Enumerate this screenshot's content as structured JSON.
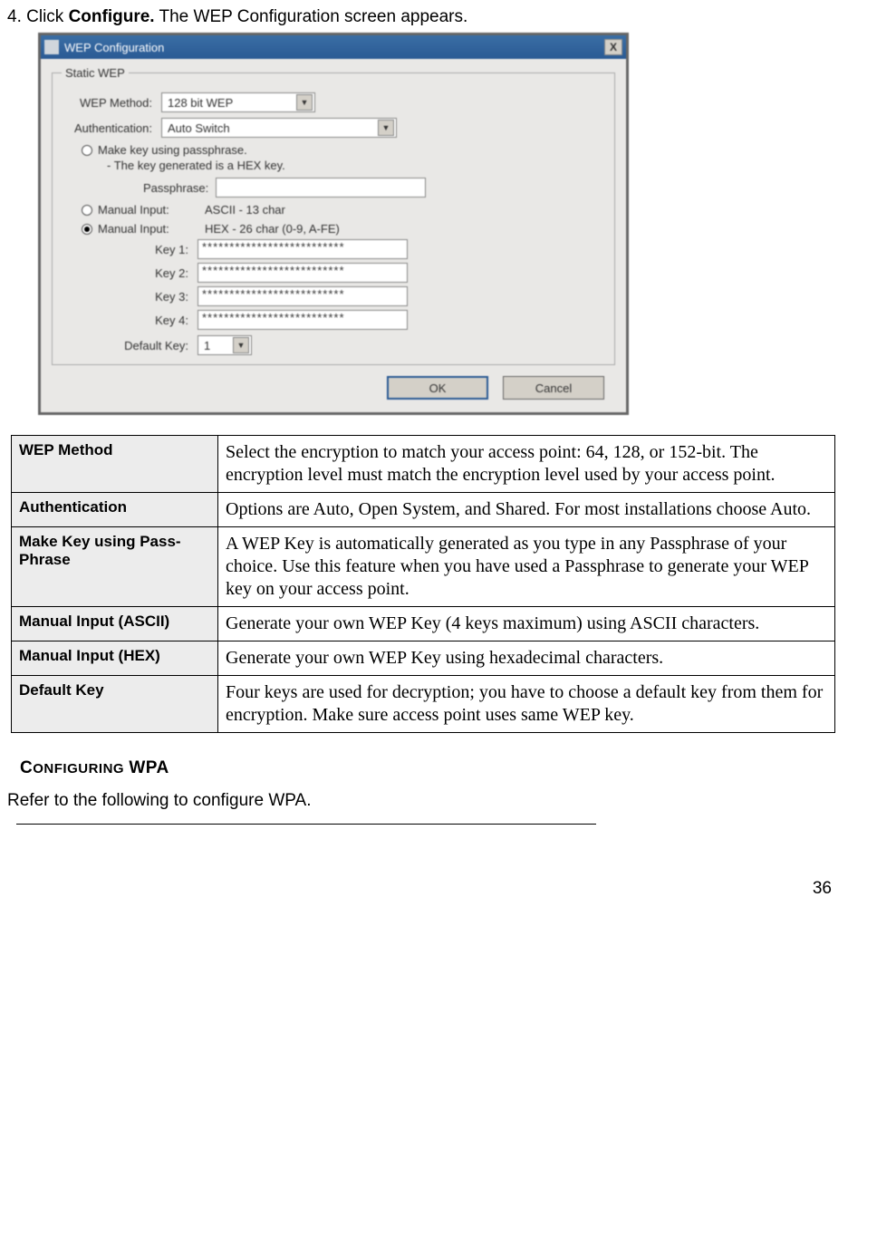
{
  "instruction": {
    "prefix": "4. Click ",
    "bold": "Configure.",
    "suffix": " The WEP Configuration screen appears."
  },
  "dialog": {
    "title": "WEP Configuration",
    "close": "X",
    "group_legend": "Static WEP",
    "wep_method_label": "WEP Method:",
    "wep_method_value": "128 bit WEP",
    "auth_label": "Authentication:",
    "auth_value": "Auto Switch",
    "radio_passphrase": "Make key using passphrase.",
    "passphrase_note": "- The key generated is a HEX key.",
    "passphrase_label": "Passphrase:",
    "passphrase_value": "",
    "radio_ascii_label": "Manual Input:",
    "radio_ascii_desc": "ASCII - 13 char",
    "radio_hex_label": "Manual Input:",
    "radio_hex_desc": "HEX - 26 char (0-9, A-FE)",
    "keys": {
      "k1_label": "Key 1:",
      "k2_label": "Key 2:",
      "k3_label": "Key 3:",
      "k4_label": "Key 4:",
      "masked": "**************************"
    },
    "default_key_label": "Default Key:",
    "default_key_value": "1",
    "ok": "OK",
    "cancel": "Cancel"
  },
  "table": {
    "r1h": "WEP Method",
    "r1v": "Select the encryption to match your access point: 64, 128, or 152-bit. The encryption level must match the encryption level used by your access point.",
    "r2h": "Authentication",
    "r2v": "Options are Auto, Open System, and Shared. For most installations choose Auto.",
    "r3h": "Make Key using Pass-Phrase",
    "r3v": "A WEP Key is automatically generated as you type in any Passphrase of your choice. Use this feature when you have used a Passphrase to generate your WEP key on your access point.",
    "r4h": "Manual Input (ASCII)",
    "r4v": "Generate your own WEP Key (4 keys maximum) using ASCII characters.",
    "r5h": "Manual Input (HEX)",
    "r5v": "Generate your own WEP Key using hexadecimal characters.",
    "r6h": "Default Key",
    "r6v": "Four keys are used for decryption; you have to choose a default key from them for encryption. Make sure access point uses same WEP key."
  },
  "wpa": {
    "heading_prefix": "C",
    "heading_rest": "ONFIGURING",
    "heading_wpa": "WPA",
    "text": "Refer to the following to configure WPA."
  },
  "page_number": "36"
}
